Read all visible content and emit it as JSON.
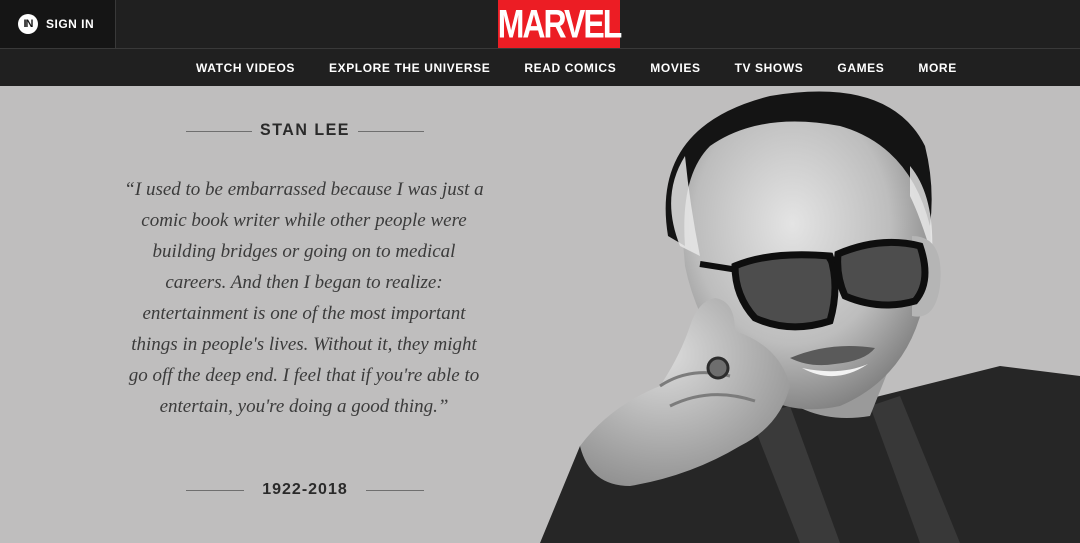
{
  "header": {
    "signin_label": "SIGN IN",
    "signin_icon_text": "IN",
    "logo_text": "MARVEL",
    "brand_color": "#ec1d24"
  },
  "nav": {
    "items": [
      "WATCH VIDEOS",
      "EXPLORE THE UNIVERSE",
      "READ COMICS",
      "MOVIES",
      "TV SHOWS",
      "GAMES",
      "MORE"
    ]
  },
  "tribute": {
    "name": "STAN LEE",
    "quote": "“I used to be embarrassed because I was just a comic book writer while other people were building bridges or going on to medical careers. And then I began to realize: entertainment is one of the most important things in people's lives. Without it, they might go off the deep end. I feel that if you're able to entertain, you're doing a good thing.”",
    "years": "1922-2018",
    "portrait_icon": "portrait-photo"
  }
}
